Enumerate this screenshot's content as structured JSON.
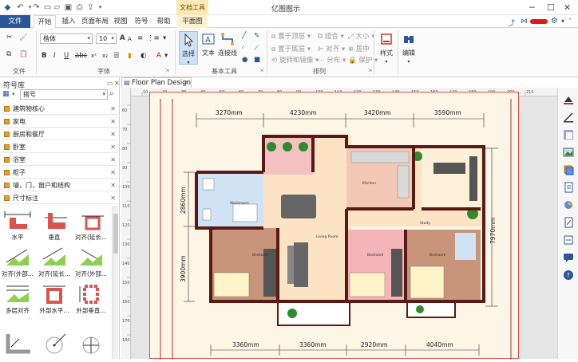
{
  "app": {
    "title": "亿图图示",
    "context_tools": "文档工具"
  },
  "tabs": {
    "file": "文件",
    "start": "开始",
    "insert": "插入",
    "layout": "页面布局",
    "view": "视图",
    "symbol": "符号",
    "help": "帮助",
    "floorplan": "平面图"
  },
  "ribbon": {
    "font_name": "楷体",
    "font_size": "10",
    "groups": {
      "file": "文件",
      "font": "字体",
      "basic_tools": "基本工具",
      "arrange": "排列"
    },
    "select": "选择",
    "text": "文本",
    "connector": "连接线",
    "bring_front": "置于顶层",
    "send_back": "置于底层",
    "rotate_mirror": "旋转和镜像",
    "group": "组合",
    "align": "对齐",
    "distribute": "分布",
    "size": "大小",
    "center": "居中",
    "protect": "保护",
    "style": "样式",
    "edit": "编辑"
  },
  "sidebar": {
    "title": "符号库",
    "search_value": "搭号",
    "items": [
      {
        "label": "建筑物核心"
      },
      {
        "label": "家电"
      },
      {
        "label": "厨房和餐厅"
      },
      {
        "label": "卧室"
      },
      {
        "label": "浴室"
      },
      {
        "label": "柜子"
      },
      {
        "label": "墙，门，窗户和结构"
      },
      {
        "label": "尺寸标注"
      }
    ],
    "symbols": [
      "水平",
      "垂直",
      "对齐(延长...",
      "对齐(外部...",
      "对齐(延长...",
      "对齐(外部...",
      "多层对齐",
      "外部水平...",
      "外部垂直..."
    ]
  },
  "document": {
    "tab_title": "Floor Plan Design 2"
  },
  "plan": {
    "top_dims": [
      "3270mm",
      "4230mm",
      "3420mm",
      "3590mm"
    ],
    "bottom_dims": [
      "3360mm",
      "3360mm",
      "2920mm",
      "4040mm"
    ],
    "left_dims": [
      "2860mm",
      "3900mm"
    ],
    "right_dim": "7970mm",
    "rooms": {
      "washroom": "Washroom",
      "kitchen": "Kitchen",
      "study": "Study",
      "living": "Living Room",
      "bedroom1": "Bedroom",
      "bedroom2": "Bedroom",
      "bedroom3": "Bedroom"
    }
  },
  "ruler": {
    "h_ticks": [
      "10",
      "20",
      "30",
      "40",
      "50",
      "60",
      "70",
      "80",
      "90",
      "100",
      "110",
      "120",
      "130",
      "140",
      "150",
      "160",
      "170",
      "180",
      "190",
      "200",
      "210"
    ],
    "v_ticks": [
      "60",
      "70",
      "80",
      "90",
      "100",
      "110",
      "120",
      "130",
      "140",
      "150",
      "160",
      "170",
      "180"
    ]
  },
  "colors": {
    "file_tab": "#2b579a",
    "wall": "#5a1a14",
    "bedroom_floor": "#c9957a",
    "pink_floor": "#f4b4b8",
    "tile": "#cfe3f5",
    "page_border": "#d9534f"
  }
}
